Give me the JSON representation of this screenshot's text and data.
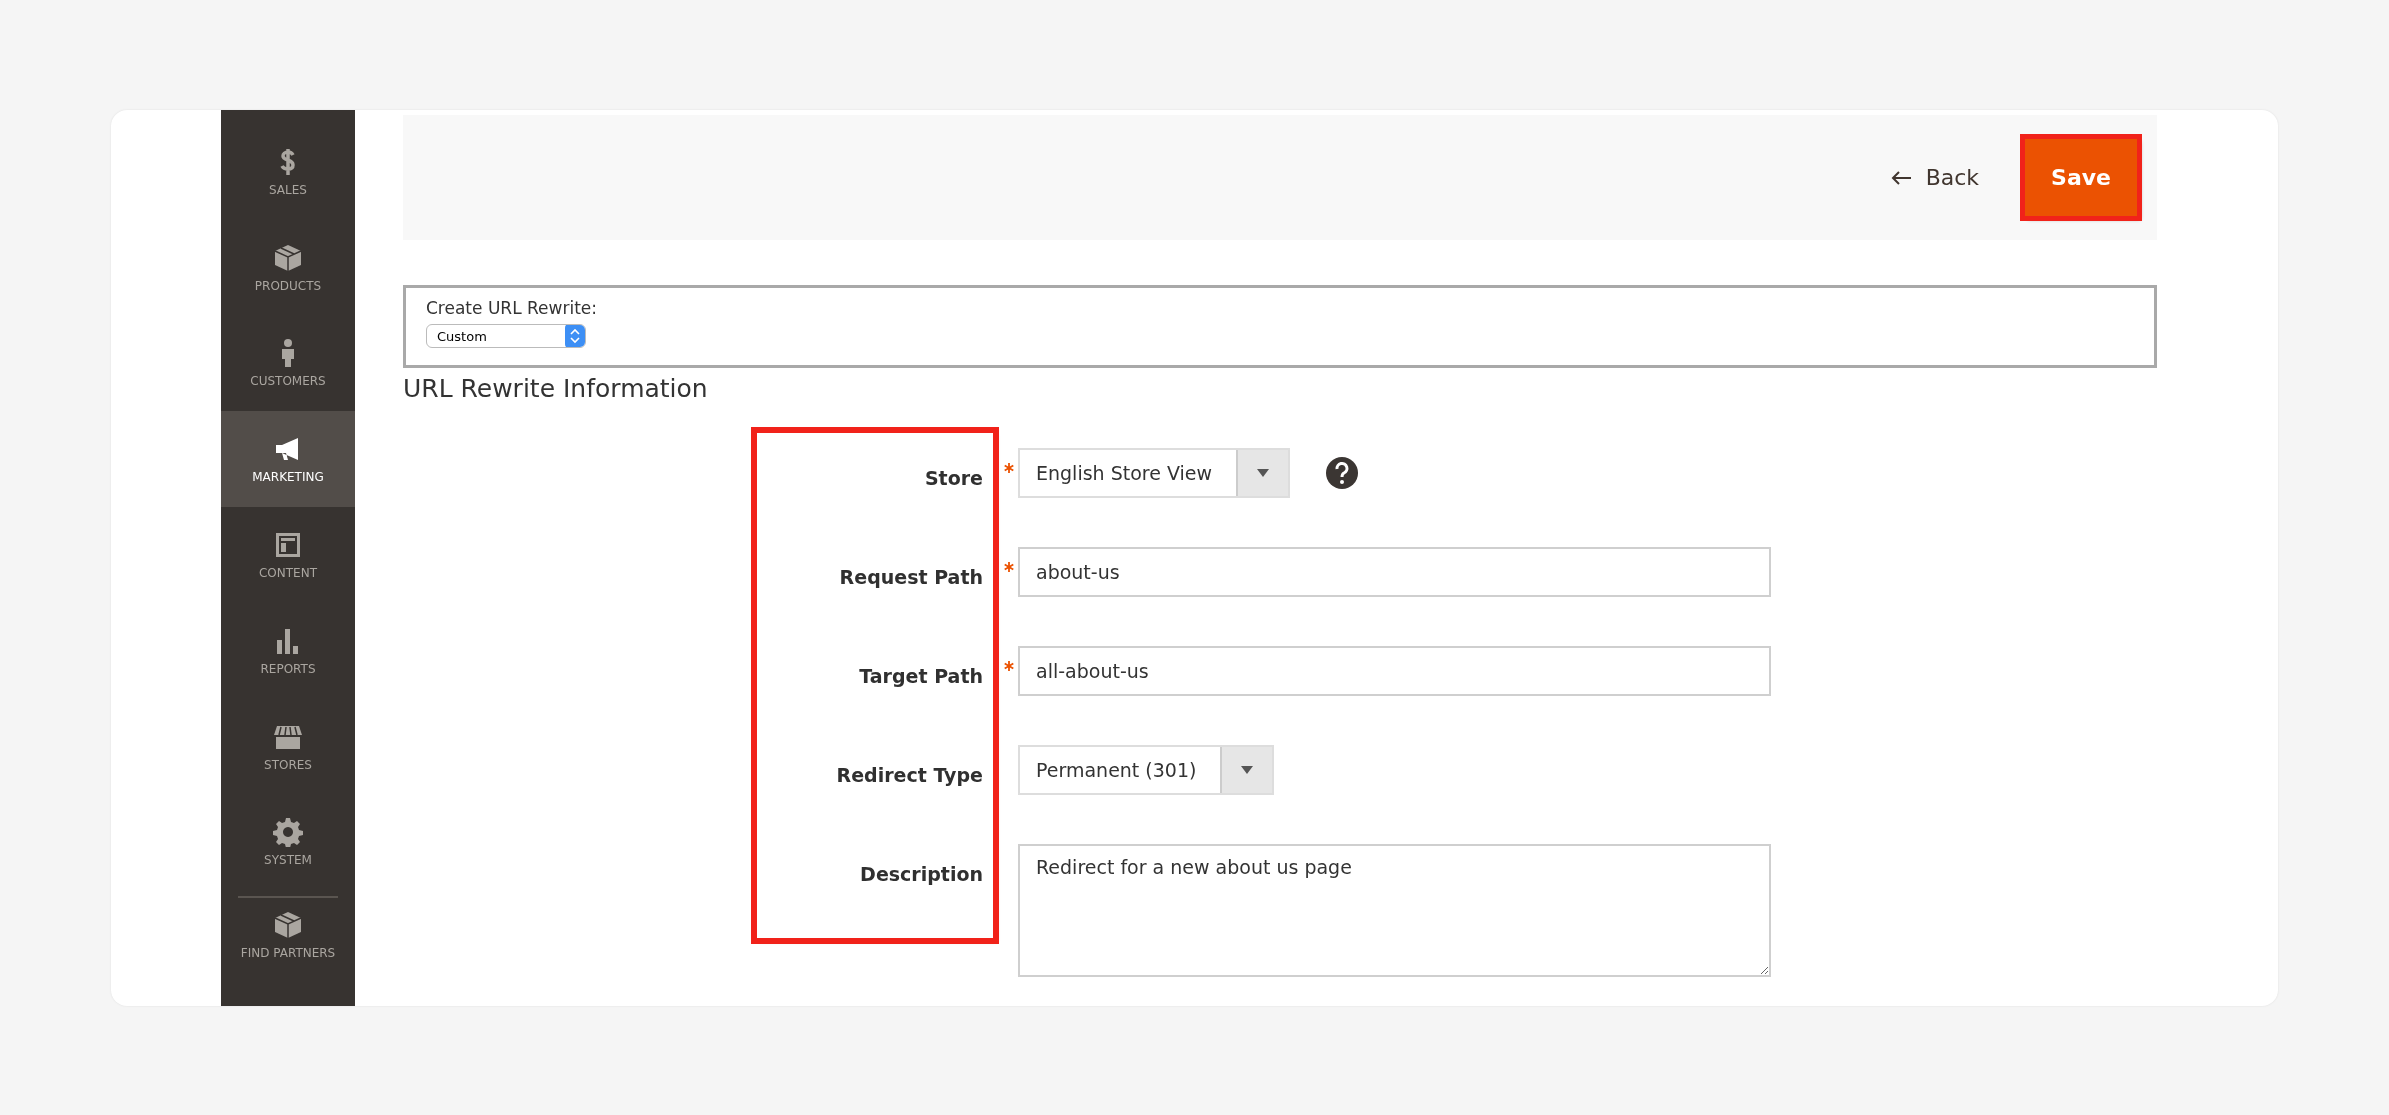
{
  "sidebar": {
    "items": [
      {
        "label": "SALES",
        "selected": false
      },
      {
        "label": "PRODUCTS",
        "selected": false
      },
      {
        "label": "CUSTOMERS",
        "selected": false
      },
      {
        "label": "MARKETING",
        "selected": true
      },
      {
        "label": "CONTENT",
        "selected": false
      },
      {
        "label": "REPORTS",
        "selected": false
      },
      {
        "label": "STORES",
        "selected": false
      },
      {
        "label": "SYSTEM",
        "selected": false
      },
      {
        "label": "FIND PARTNERS",
        "selected": false
      }
    ]
  },
  "header": {
    "back": "Back",
    "save": {
      "label": "Save",
      "highlighted": true
    }
  },
  "create": {
    "label": "Create URL Rewrite:",
    "select": "Custom"
  },
  "section_title": "URL Rewrite Information",
  "form": {
    "labels_highlighted": true,
    "fields": [
      {
        "kind": "select",
        "label": "Store",
        "required": true,
        "value": "English Store View",
        "help": true
      },
      {
        "kind": "input",
        "label": "Request Path",
        "required": true,
        "value": "about-us"
      },
      {
        "kind": "input",
        "label": "Target Path",
        "required": true,
        "value": "all-about-us"
      },
      {
        "kind": "select",
        "label": "Redirect Type",
        "required": false,
        "value": "Permanent (301)"
      },
      {
        "kind": "textarea",
        "label": "Description",
        "required": false,
        "value": "Redirect for a new about us page"
      }
    ]
  }
}
